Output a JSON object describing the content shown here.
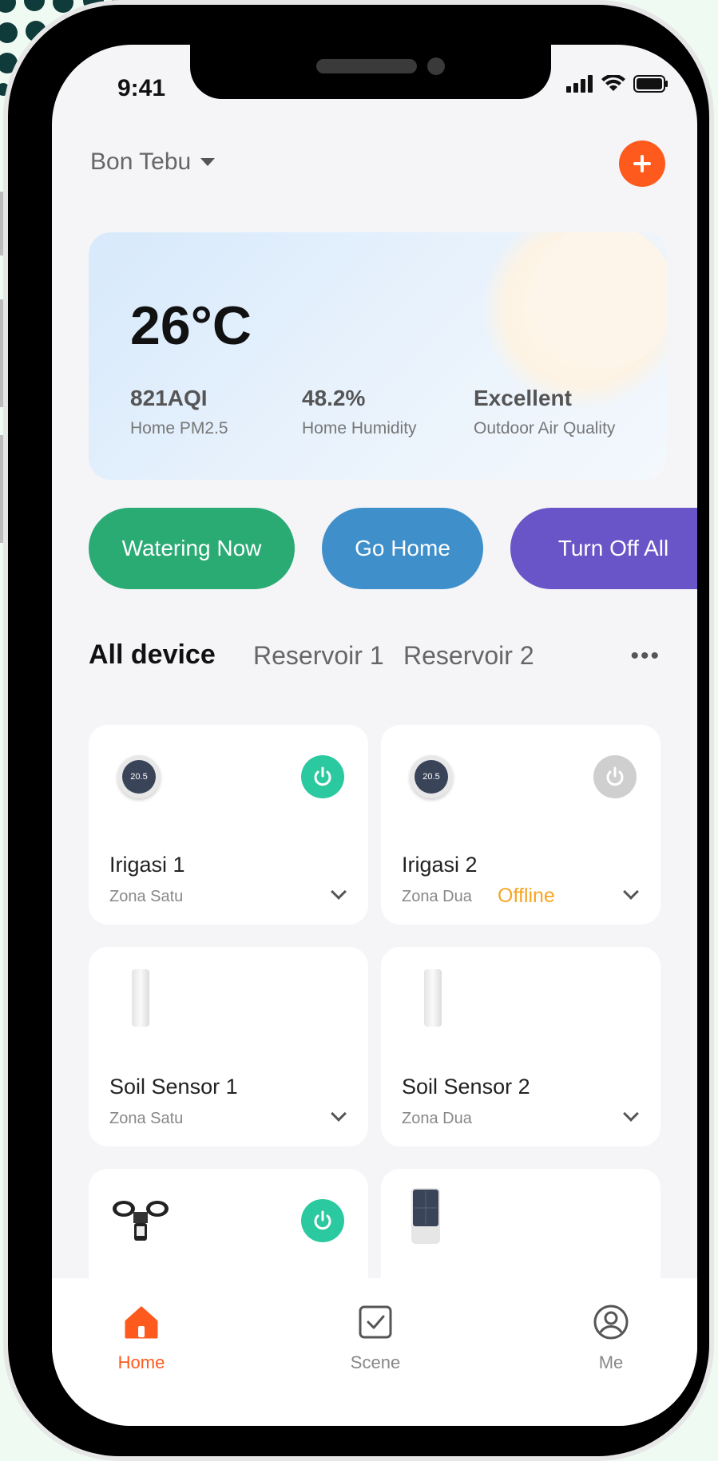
{
  "status": {
    "time": "9:41"
  },
  "home": {
    "title": "Bon Tebu"
  },
  "weather": {
    "temperature": "26°C",
    "stats": [
      {
        "value": "821AQI",
        "label": "Home PM2.5"
      },
      {
        "value": "48.2%",
        "label": "Home Humidity"
      },
      {
        "value": "Excellent",
        "label": "Outdoor Air Quality"
      }
    ]
  },
  "scenes": [
    {
      "label": "Watering Now",
      "color": "#2bab74"
    },
    {
      "label": "Go Home",
      "color": "#3f8fcb"
    },
    {
      "label": "Turn Off All",
      "color": "#6a55c8"
    }
  ],
  "tabs": [
    "All device",
    "Reservoir 1",
    "Reservoir 2"
  ],
  "devices": [
    {
      "name": "Irigasi 1",
      "zone": "Zona Satu",
      "thermo": "20.5",
      "power": "on"
    },
    {
      "name": "Irigasi 2",
      "zone": "Zona Dua",
      "thermo": "20.5",
      "power": "off",
      "status": "Offline"
    },
    {
      "name": "Soil Sensor 1",
      "zone": "Zona Satu"
    },
    {
      "name": "Soil Sensor 2",
      "zone": "Zona Dua"
    }
  ],
  "colors": {
    "accent": "#fe5a1d",
    "power_on": "#2bc9a0",
    "power_off": "#cfcfcf",
    "offline": "#f5a623"
  },
  "tabbar": {
    "items": [
      {
        "label": "Home",
        "icon": "home-icon",
        "active": true
      },
      {
        "label": "Scene",
        "icon": "scene-checkbox-icon",
        "active": false
      },
      {
        "label": "Me",
        "icon": "user-icon",
        "active": false
      }
    ]
  }
}
